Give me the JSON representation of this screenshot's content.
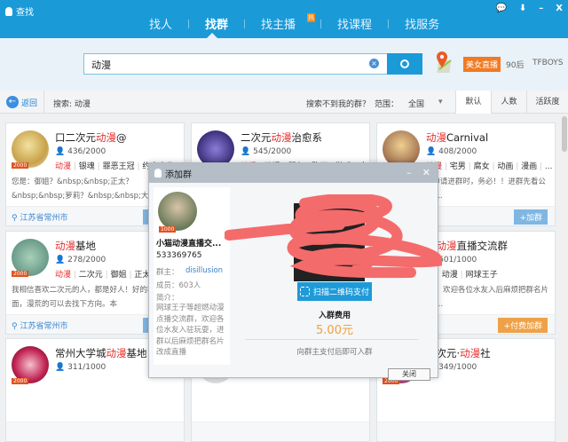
{
  "app": {
    "title": "查找",
    "window_buttons": [
      "💬",
      "⬇",
      "–",
      "X"
    ]
  },
  "tabs": [
    {
      "label": "找人"
    },
    {
      "label": "找群",
      "active": true
    },
    {
      "label": "找主播",
      "badge": "热"
    },
    {
      "label": "找课程"
    },
    {
      "label": "找服务"
    }
  ],
  "search": {
    "value": "动漫",
    "hot_badge": "美女直播",
    "keywords": [
      "90后",
      "TFBOYS"
    ]
  },
  "toolbar": {
    "back": "返回",
    "query": "搜索: 动漫",
    "not_found": "搜索不到我的群？",
    "range_label": "范围：",
    "range_value": "全国",
    "sort": [
      "默认",
      "人数",
      "活跃度"
    ]
  },
  "colors": {
    "brand": "#1b9ad8",
    "highlight": "#e5312f",
    "pay": "#eda24a"
  },
  "cards": [
    {
      "pre": "口二次元",
      "hl": "动漫",
      "post": "@",
      "count": "436/2000",
      "tags": [
        "动漫",
        "银魂",
        "罪恶王冠",
        "约会大作"
      ],
      "desc": "您是：御姐？&nbsp;&nbsp;正太？&nbsp;&nbsp;萝莉？&nbsp;&nbsp;大叔？&nbsp;&nbsp;",
      "loc": "江苏省常州市",
      "btn": "» 进入"
    },
    {
      "pre": "二次元",
      "hl": "动漫",
      "post": "治愈系",
      "count": "545/2000",
      "tags": [
        "动漫",
        "动漫",
        "朋友",
        "聊天",
        "游戏",
        "宅"
      ],
      "desc": "",
      "loc": "",
      "btn": ""
    },
    {
      "pre": "",
      "hl": "动漫",
      "post": "Carnival",
      "count": "408/2000",
      "tags": [
        "动漫",
        "宅男",
        "腐女",
        "动画",
        "漫画",
        "..."
      ],
      "desc": "告 第二天退还 申请进群时，务必！！进群先看公告自觉改马甲。...",
      "loc": "",
      "btn": "+加群"
    },
    {
      "pre": "",
      "hl": "动漫",
      "post": "基地",
      "count": "278/2000",
      "tags": [
        "动漫",
        "二次元",
        "御姐",
        "正太"
      ],
      "desc": "我相信喜欢二次元的人，都是好人！好的群推荐里面，漫荒的可以去找下方向。本",
      "loc": "江苏省常州市",
      "btn": "» 进入"
    },
    {
      "pre": "",
      "hl": "",
      "post": "",
      "count": "",
      "tags": [],
      "desc": "",
      "loc": "",
      "btn": ""
    },
    {
      "pre": "猫",
      "hl": "动漫",
      "post": "直播交流群",
      "count": "601/1000",
      "tags": [
        "美",
        "动漫",
        "网球王子"
      ],
      "desc": "动漫点播交流群，欢迎各位水友入后麻烦把群名片改成直播ID，需...",
      "loc": "",
      "btn": "+付费加群",
      "pay": true
    },
    {
      "pre": "常州大学城",
      "hl": "动漫",
      "post": "基地",
      "count": "311/1000",
      "tags": [],
      "desc": "",
      "loc": "",
      "btn": ""
    },
    {
      "pre": "",
      "hl": "",
      "post": "",
      "count": "",
      "tags": [],
      "desc": "",
      "loc": "",
      "btn": ""
    },
    {
      "pre": "异次元·",
      "hl": "动漫",
      "post": "社",
      "count": "349/1000",
      "tags": [],
      "desc": "",
      "loc": "",
      "btn": ""
    }
  ],
  "dialog": {
    "title": "添加群",
    "group_name": "小猫动漫直播交...",
    "group_id": "533369765",
    "owner_label": "群主：",
    "owner": "disillusion",
    "members": "成员：603人",
    "intro_label": "简介：",
    "intro": "网球王子等超燃动漫点播交流群，欢迎各位水友入驻玩耍，进群以后麻烦把群名片改成直播",
    "qr_button": "扫描二维码支付",
    "fee_label": "入群费用",
    "fee": "5.00元",
    "note": "向群主支付后即可入群",
    "close": "关闭"
  }
}
